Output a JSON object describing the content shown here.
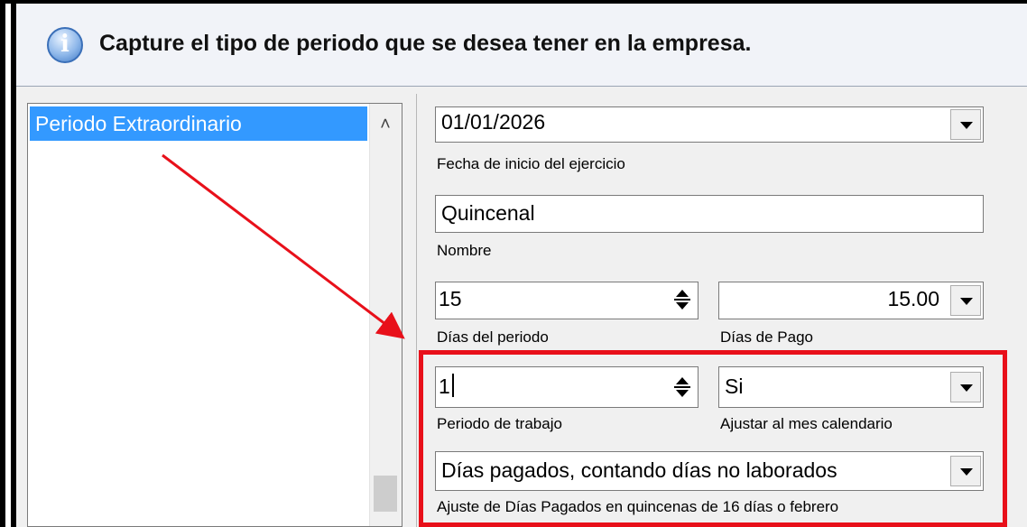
{
  "header": {
    "icon": "info-icon",
    "message": "Capture el tipo de periodo que se desea tener en la empresa."
  },
  "period_list": {
    "items": [
      {
        "label": "Periodo Extraordinario",
        "selected": true
      }
    ]
  },
  "form": {
    "fecha_inicio": {
      "value": "01/01/2026",
      "label": "Fecha de inicio del ejercicio"
    },
    "nombre": {
      "value": "Quincenal",
      "label": "Nombre"
    },
    "dias_periodo": {
      "value": "15",
      "label": "Días del periodo"
    },
    "dias_pago": {
      "value": "15.00",
      "label": "Días de Pago"
    },
    "periodo_trabajo": {
      "value": "1",
      "label": "Periodo de trabajo"
    },
    "ajustar_mes": {
      "value": "Si",
      "label": "Ajustar al mes calendario"
    },
    "ajuste_dias": {
      "value": "Días pagados, contando días no laborados",
      "label": "Ajuste de Días Pagados en quincenas de 16 días o febrero"
    }
  },
  "annotation": {
    "highlight_color": "#e8101a",
    "arrow_color": "#e8101a"
  },
  "colors": {
    "selection": "#3399ff",
    "header_bg": "#f1f3f8",
    "panel_bg": "#f0f0f0"
  }
}
